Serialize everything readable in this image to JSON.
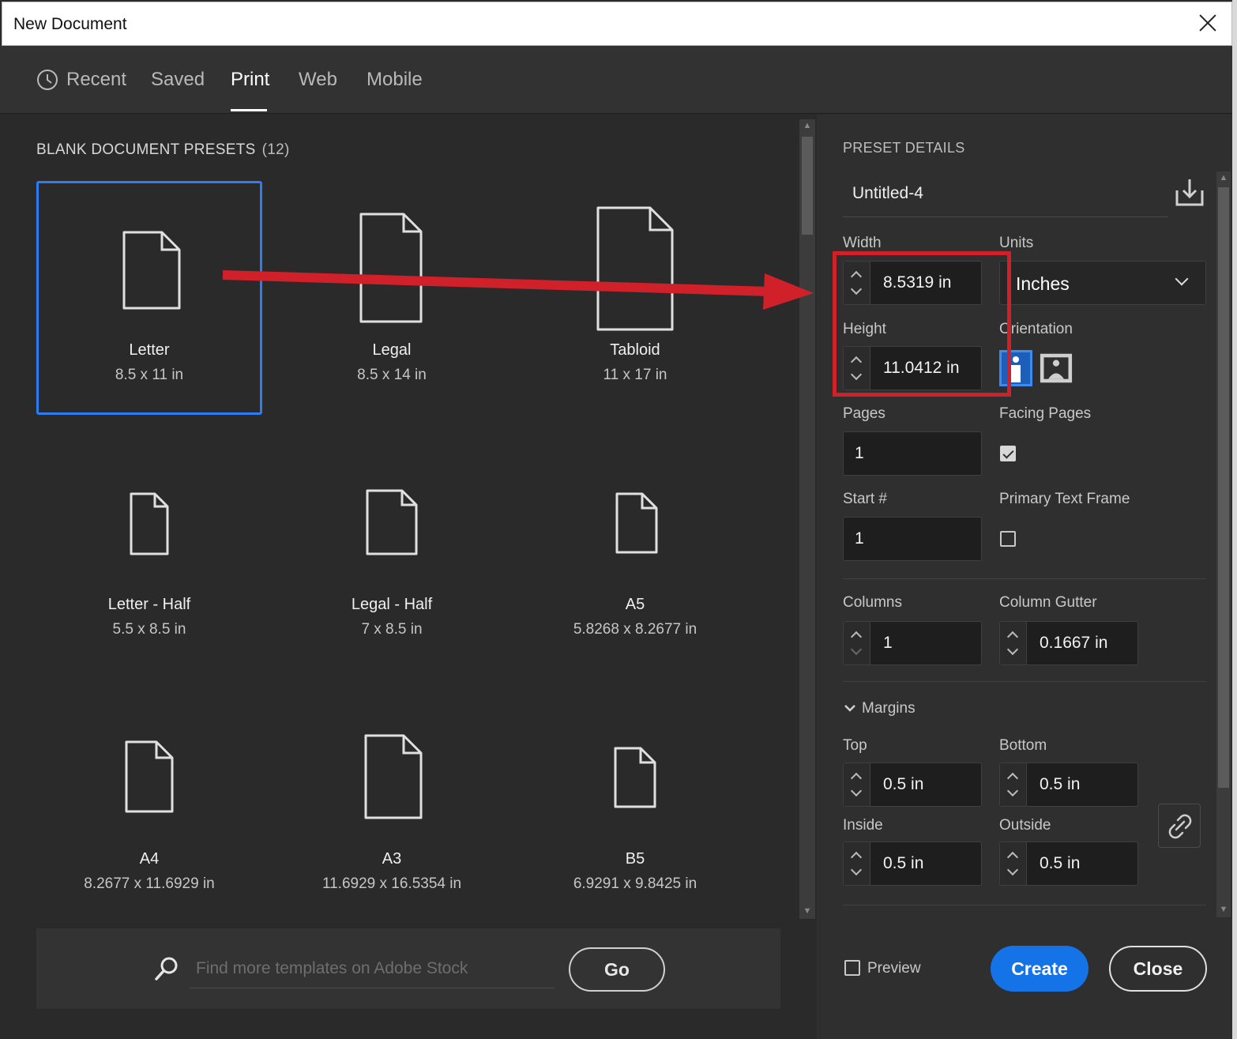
{
  "window": {
    "title": "New Document"
  },
  "tabs": [
    {
      "label": "Recent",
      "icon": "clock-icon"
    },
    {
      "label": "Saved"
    },
    {
      "label": "Print",
      "active": true
    },
    {
      "label": "Web"
    },
    {
      "label": "Mobile"
    }
  ],
  "presets_panel": {
    "title": "BLANK DOCUMENT PRESETS",
    "count": "(12)",
    "items": [
      {
        "name": "Letter",
        "size": "8.5 x 11 in",
        "selected": true
      },
      {
        "name": "Legal",
        "size": "8.5 x 14 in"
      },
      {
        "name": "Tabloid",
        "size": "11 x 17 in"
      },
      {
        "name": "Letter - Half",
        "size": "5.5 x 8.5 in"
      },
      {
        "name": "Legal - Half",
        "size": "7 x 8.5 in"
      },
      {
        "name": "A5",
        "size": "5.8268 x 8.2677 in"
      },
      {
        "name": "A4",
        "size": "8.2677 x 11.6929 in"
      },
      {
        "name": "A3",
        "size": "11.6929 x 16.5354 in"
      },
      {
        "name": "B5",
        "size": "6.9291 x 9.8425 in"
      }
    ]
  },
  "stock": {
    "placeholder": "Find more templates on Adobe Stock",
    "go_label": "Go"
  },
  "details": {
    "header": "PRESET DETAILS",
    "doc_name": "Untitled-4",
    "width_label": "Width",
    "width_value": "8.5319 in",
    "units_label": "Units",
    "units_value": "Inches",
    "height_label": "Height",
    "height_value": "11.0412 in",
    "orientation_label": "Orientation",
    "orientation": "portrait",
    "pages_label": "Pages",
    "pages_value": "1",
    "facing_pages_label": "Facing Pages",
    "facing_pages_checked": true,
    "start_label": "Start #",
    "start_value": "1",
    "primary_text_frame_label": "Primary Text Frame",
    "primary_text_frame_checked": false,
    "columns_label": "Columns",
    "columns_value": "1",
    "gutter_label": "Column Gutter",
    "gutter_value": "0.1667 in",
    "margins_label": "Margins",
    "top_label": "Top",
    "top_value": "0.5 in",
    "bottom_label": "Bottom",
    "bottom_value": "0.5 in",
    "inside_label": "Inside",
    "inside_value": "0.5 in",
    "outside_label": "Outside",
    "outside_value": "0.5 in"
  },
  "footer": {
    "preview_label": "Preview",
    "create_label": "Create",
    "close_label": "Close"
  },
  "colors": {
    "accent": "#1473e6",
    "selection": "#2d7cf2",
    "annotation": "#d0202a"
  }
}
